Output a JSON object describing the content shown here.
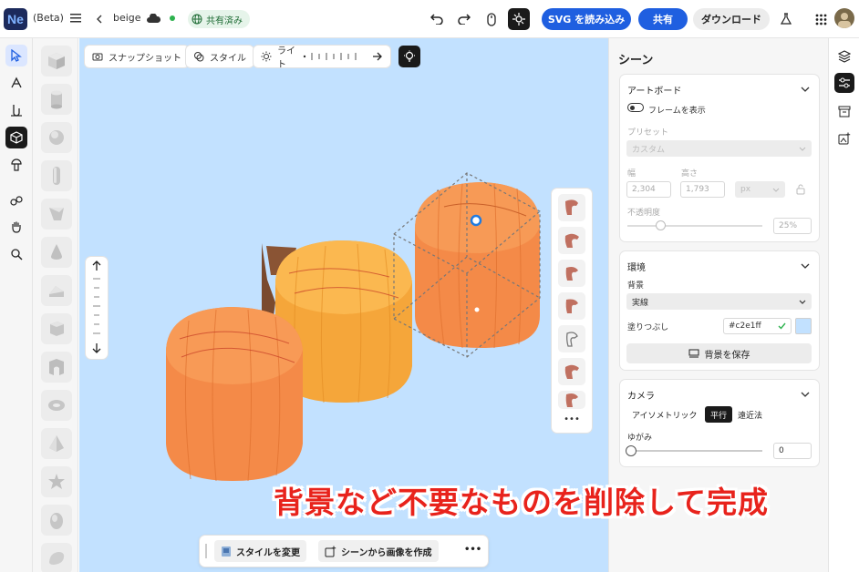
{
  "app": {
    "logo": "Ne",
    "beta": "(Beta)",
    "doc_name": "beige",
    "shared_badge": "共有済み"
  },
  "toolbar": {
    "svg_import": "SVG を読み込み",
    "share": "共有",
    "download": "ダウンロード"
  },
  "canvas_toolbar": {
    "snapshot": "スナップショット",
    "style": "スタイル",
    "light": "ライト"
  },
  "bottom_bar": {
    "change_style": "スタイルを変更",
    "create_image": "シーンから画像を作成",
    "more": "•••"
  },
  "variants_more": "•••",
  "panel": {
    "title": "シーン",
    "artboard": {
      "title": "アートボード",
      "show_frame": "フレームを表示",
      "preset_label": "プリセット",
      "preset_value": "カスタム",
      "width_label": "幅",
      "width_value": "2,304",
      "height_label": "高さ",
      "height_value": "1,793",
      "unit_value": "px",
      "opacity_label": "不透明度",
      "opacity_value": "25%",
      "opacity_fraction": 0.25
    },
    "environment": {
      "title": "環境",
      "background_label": "背景",
      "background_value": "実線",
      "fill_label": "塗りつぶし",
      "fill_value": "#c2e1ff",
      "fill_color": "#c2e1ff",
      "save_bg": "背景を保存"
    },
    "camera": {
      "title": "カメラ",
      "isometric": "アイソメトリック",
      "parallel": "平行",
      "perspective": "遠近法",
      "distortion_label": "ゆがみ",
      "distortion_value": "0",
      "distortion_fraction": 0
    }
  },
  "overlay": {
    "caption": "背景など不要なものを削除して完成"
  },
  "colors": {
    "accent": "#1f5fe0",
    "canvas_bg": "#c2e1ff",
    "pumpkin": "#f79a52",
    "caption": "#e8231c"
  }
}
